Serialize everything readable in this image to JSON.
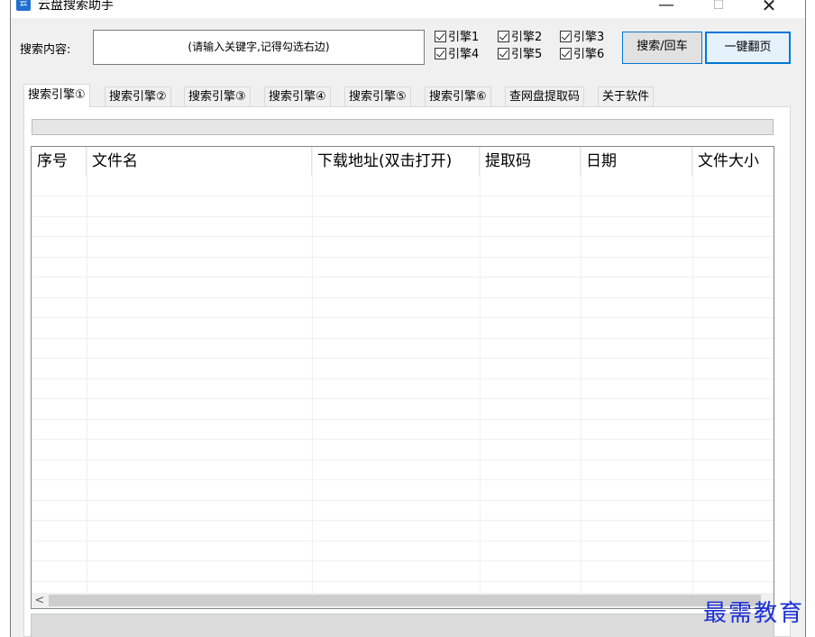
{
  "window": {
    "title": "云盘搜索助手",
    "icon_text": "云",
    "minimize": "—",
    "maximize": "☐",
    "close": "✕"
  },
  "search": {
    "label": "搜索内容:",
    "input_value": "(请输入关键字,记得勾选右边)"
  },
  "engines": [
    {
      "label": "引擎1",
      "checked": true
    },
    {
      "label": "引擎2",
      "checked": true
    },
    {
      "label": "引擎3",
      "checked": true
    },
    {
      "label": "引擎4",
      "checked": true
    },
    {
      "label": "引擎5",
      "checked": true
    },
    {
      "label": "引擎6",
      "checked": true
    }
  ],
  "buttons": {
    "search": "搜索/回车",
    "page": "一键翻页"
  },
  "tabs": [
    {
      "label": "搜索引擎①",
      "active": true
    },
    {
      "label": "搜索引擎②",
      "active": false
    },
    {
      "label": "搜索引擎③",
      "active": false
    },
    {
      "label": "搜索引擎④",
      "active": false
    },
    {
      "label": "搜索引擎⑤",
      "active": false
    },
    {
      "label": "搜索引擎⑥",
      "active": false
    },
    {
      "label": "查网盘提取码",
      "active": false
    },
    {
      "label": "关于软件",
      "active": false
    }
  ],
  "progress": {
    "value": 0
  },
  "list": {
    "columns": [
      "序号",
      "文件名",
      "下载地址(双击打开)",
      "提取码",
      "日期",
      "文件大小"
    ],
    "rows": []
  },
  "scrollbar": {
    "left_arrow": "<"
  },
  "watermark": "最需教育",
  "colors": {
    "accent": "#0078d7",
    "watermark": "#1a2fd6"
  }
}
